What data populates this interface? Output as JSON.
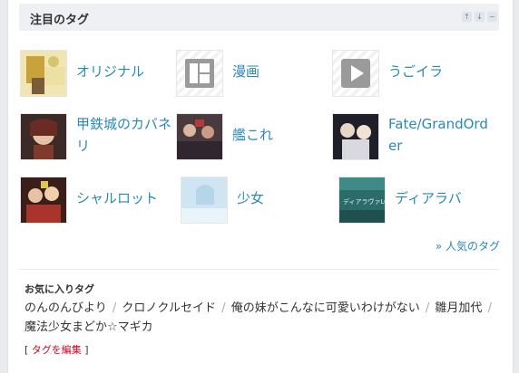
{
  "widget": {
    "title": "注目のタグ",
    "controls": [
      "↑",
      "↓",
      "−"
    ]
  },
  "tags": [
    {
      "label": "オリジナル",
      "thumb": "illustration"
    },
    {
      "label": "漫画",
      "thumb": "manga-icon"
    },
    {
      "label": "うごイラ",
      "thumb": "play-icon"
    },
    {
      "label": "甲鉄城のカバネリ",
      "thumb": "illustration"
    },
    {
      "label": "艦これ",
      "thumb": "illustration"
    },
    {
      "label": "Fate/GrandOrder",
      "thumb": "illustration"
    },
    {
      "label": "シャルロット",
      "thumb": "illustration"
    },
    {
      "label": "少女",
      "thumb": "illustration"
    },
    {
      "label": "ディアラバ",
      "thumb": "illustration"
    }
  ],
  "thumb_text": {
    "dialover": "ディアラヴァLOG"
  },
  "ranking_link": "» 人気のタグ",
  "favorites": {
    "title": "お気に入りタグ",
    "items": [
      "のんのんびより",
      "クロノクルセイド",
      "俺の妹がこんなに可愛いわけがない",
      "雛月加代",
      "魔法少女まどか☆マギカ"
    ],
    "separator": "/",
    "edit_open": "[ ",
    "edit_label": "タグを編集",
    "edit_close": " ]"
  },
  "colors": {
    "link": "#2a88b8",
    "edit": "#d0021b",
    "header_bg": "#eef0f3"
  }
}
